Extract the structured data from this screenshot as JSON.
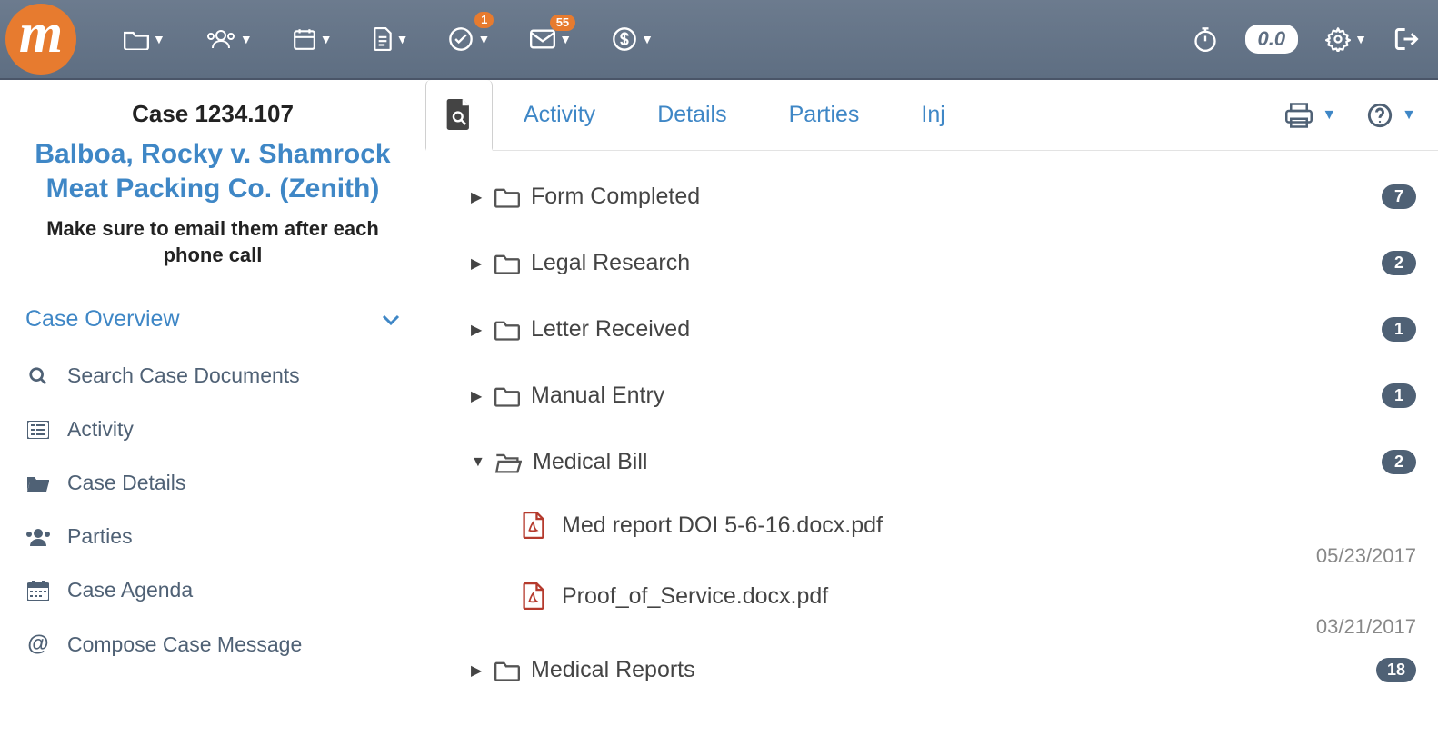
{
  "logo_text": "m",
  "topbar": {
    "notify_checkmark": "1",
    "notify_mail": "55",
    "timer_value": "0.0"
  },
  "sidebar": {
    "case_number": "Case 1234.107",
    "case_title": "Balboa, Rocky v. Shamrock Meat Packing Co. (Zenith)",
    "case_note": "Make sure to email them after each phone call",
    "overview_label": "Case Overview",
    "items": {
      "search": "Search Case Documents",
      "activity": "Activity",
      "details": "Case Details",
      "parties": "Parties",
      "agenda": "Case Agenda",
      "compose": "Compose Case Message"
    }
  },
  "tabs": {
    "activity": "Activity",
    "details": "Details",
    "parties": "Parties",
    "inj": "Inj"
  },
  "folders": [
    {
      "name": "Form Completed",
      "count": "7",
      "expanded": false
    },
    {
      "name": "Legal Research",
      "count": "2",
      "expanded": false
    },
    {
      "name": "Letter Received",
      "count": "1",
      "expanded": false
    },
    {
      "name": "Manual Entry",
      "count": "1",
      "expanded": false
    },
    {
      "name": "Medical Bill",
      "count": "2",
      "expanded": true,
      "files": [
        {
          "name": "Med report DOI 5-6-16.docx.pdf",
          "date": "05/23/2017"
        },
        {
          "name": "Proof_of_Service.docx.pdf",
          "date": "03/21/2017"
        }
      ]
    },
    {
      "name": "Medical Reports",
      "count": "18",
      "expanded": false
    }
  ]
}
